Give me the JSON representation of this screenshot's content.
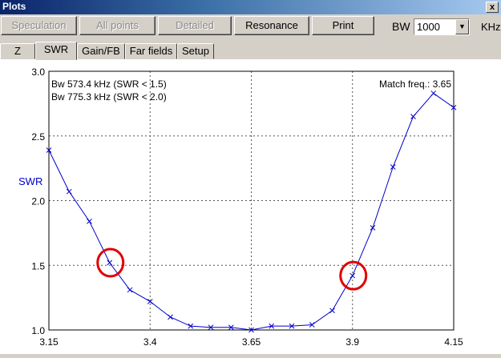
{
  "window": {
    "title": "Plots",
    "close_label": "x"
  },
  "toolbar": {
    "buttons": [
      {
        "label": "Speculation",
        "enabled": false
      },
      {
        "label": "All points",
        "enabled": false
      },
      {
        "label": "Detailed",
        "enabled": false
      },
      {
        "label": "Resonance",
        "enabled": true
      },
      {
        "label": "Print",
        "enabled": true
      }
    ],
    "bw_label": "BW",
    "bw_value": "1000",
    "unit": "KHz"
  },
  "tabs": [
    {
      "label": "Z",
      "active": false
    },
    {
      "label": "SWR",
      "active": true
    },
    {
      "label": "Gain/FB",
      "active": false
    },
    {
      "label": "Far fields",
      "active": false
    },
    {
      "label": "Setup",
      "active": false
    }
  ],
  "annotations": {
    "bw1": "Bw 573.4 kHz (SWR < 1.5)",
    "bw2": "Bw 775.3 kHz (SWR < 2.0)",
    "match": "Match freq.: 3.65"
  },
  "chart_data": {
    "type": "line",
    "ylabel": "SWR",
    "xlabel": "",
    "xlim": [
      3.15,
      4.15
    ],
    "ylim": [
      1.0,
      3.0
    ],
    "x_ticks": [
      "3.15",
      "3.4",
      "3.65",
      "3.9",
      "4.15"
    ],
    "y_ticks": [
      "1.0",
      "1.5",
      "2.0",
      "2.5",
      "3.0"
    ],
    "grid": "dashed",
    "series": [
      {
        "color": "#0000cc",
        "x": [
          3.15,
          3.2,
          3.25,
          3.3,
          3.35,
          3.4,
          3.45,
          3.5,
          3.55,
          3.6,
          3.65,
          3.7,
          3.75,
          3.8,
          3.85,
          3.9,
          3.95,
          4.0,
          4.05,
          4.1,
          4.15
        ],
        "y": [
          2.39,
          2.07,
          1.84,
          1.52,
          1.31,
          1.22,
          1.1,
          1.03,
          1.02,
          1.02,
          1.0,
          1.03,
          1.03,
          1.04,
          1.15,
          1.42,
          1.79,
          2.26,
          2.65,
          2.83,
          2.72
        ]
      }
    ],
    "highlights": [
      {
        "x": 3.3,
        "y": 1.52,
        "color": "#e00000"
      },
      {
        "x": 3.9,
        "y": 1.42,
        "color": "#e00000"
      }
    ]
  }
}
